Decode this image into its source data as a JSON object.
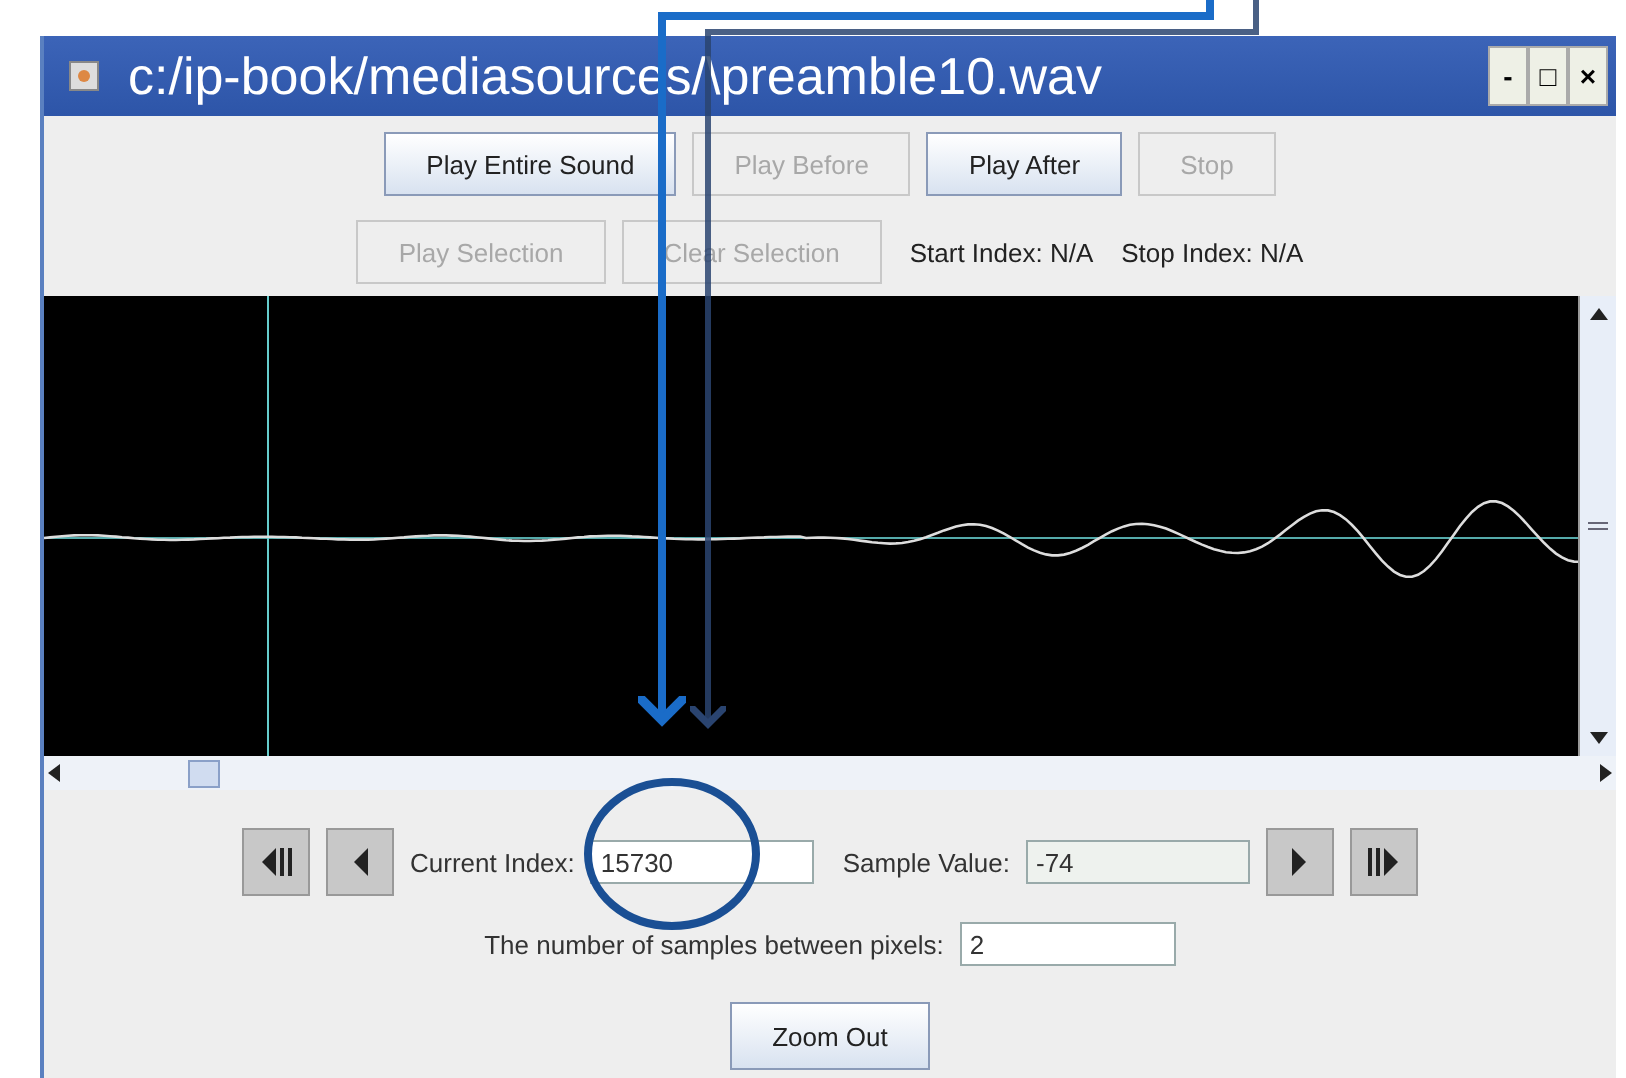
{
  "window": {
    "title": "c:/ip-book/mediasources/\\preamble10.wav",
    "controls": [
      "-",
      "□",
      "×"
    ]
  },
  "play_buttons": [
    {
      "label": "Play Entire Sound",
      "disabled": false
    },
    {
      "label": "Play Before",
      "disabled": true
    },
    {
      "label": "Play After",
      "disabled": false
    },
    {
      "label": "Stop",
      "disabled": true
    }
  ],
  "selection_buttons": [
    {
      "label": "Play Selection",
      "disabled": true
    },
    {
      "label": "Clear Selection",
      "disabled": true
    }
  ],
  "selection_info": [
    "Start Index: N/A",
    "Stop Index: N/A"
  ],
  "current_index": {
    "label": "Current Index:",
    "value": "15730"
  },
  "sample_value": {
    "label": "Sample Value:",
    "value": "-74"
  },
  "samples_between_pixels": {
    "label": "The number of samples between pixels:",
    "value": "2"
  },
  "zoom_button": {
    "label": "Zoom Out"
  }
}
